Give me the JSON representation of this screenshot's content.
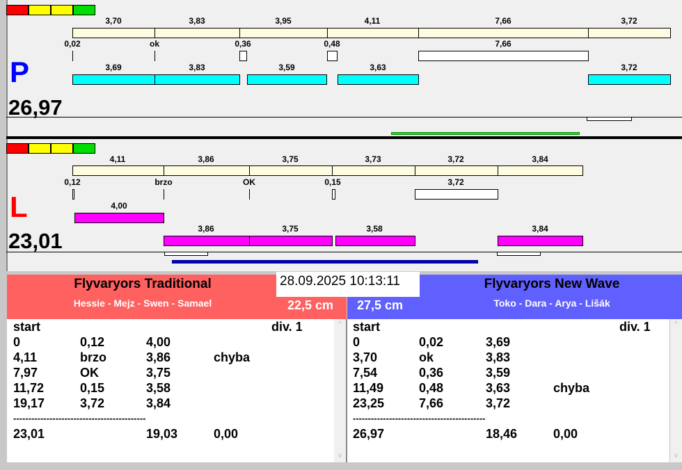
{
  "colors": {
    "indicator": [
      "#ff0000",
      "#ffff00",
      "#ffff00",
      "#00dd00"
    ],
    "team_left": "#ff6060",
    "team_right": "#6060ff",
    "p_letter": "#0000ff",
    "l_letter": "#ff0000"
  },
  "panel_p": {
    "letter": "P",
    "total": "26,97",
    "top_labels": [
      "3,70",
      "3,83",
      "3,95",
      "4,11",
      "7,66",
      "3,72"
    ],
    "mid_labels": [
      "0,02",
      "ok",
      "0,36",
      "0,48",
      "7,66"
    ],
    "bar_labels": [
      "3,69",
      "3,83",
      "3,59",
      "3,63",
      "3,72"
    ]
  },
  "panel_l": {
    "letter": "L",
    "total": "23,01",
    "top_labels": [
      "4,11",
      "3,86",
      "3,75",
      "3,73",
      "3,72",
      "3,84"
    ],
    "mid_labels": [
      "0,12",
      "brzo",
      "OK",
      "0,15",
      "3,72"
    ],
    "extra_label": "4,00",
    "bar_labels": [
      "3,86",
      "3,75",
      "3,58",
      "3,84"
    ]
  },
  "datetime": "28.09.2025 10:13:11",
  "left_team": {
    "name": "Flyvaryors Traditional",
    "members": "Hessie - Mejz - Swen - Samael",
    "distance": "22,5 cm",
    "start": "start",
    "div": "div.  1",
    "rows": [
      [
        "0",
        "0,12",
        "4,00",
        ""
      ],
      [
        "4,11",
        "brzo",
        "3,86",
        "chyba"
      ],
      [
        "7,97",
        "OK",
        "3,75",
        ""
      ],
      [
        "11,72",
        "0,15",
        "3,58",
        ""
      ],
      [
        "19,17",
        "3,72",
        "3,84",
        ""
      ]
    ],
    "separator": "--------------------------------------------",
    "totals": [
      "23,01",
      "19,03",
      "0,00"
    ]
  },
  "right_team": {
    "name": "Flyvaryors New Wave",
    "members": "Toko - Dara - Arya - Lišák",
    "distance": "27,5 cm",
    "start": "start",
    "div": "div.  1",
    "rows": [
      [
        "0",
        "0,02",
        "3,69",
        ""
      ],
      [
        "3,70",
        "ok",
        "3,83",
        ""
      ],
      [
        "7,54",
        "0,36",
        "3,59",
        ""
      ],
      [
        "11,49",
        "0,48",
        "3,63",
        "chyba"
      ],
      [
        "23,25",
        "7,66",
        "3,72",
        ""
      ]
    ],
    "separator": "--------------------------------------------",
    "totals": [
      "26,97",
      "18,46",
      "0,00"
    ]
  }
}
